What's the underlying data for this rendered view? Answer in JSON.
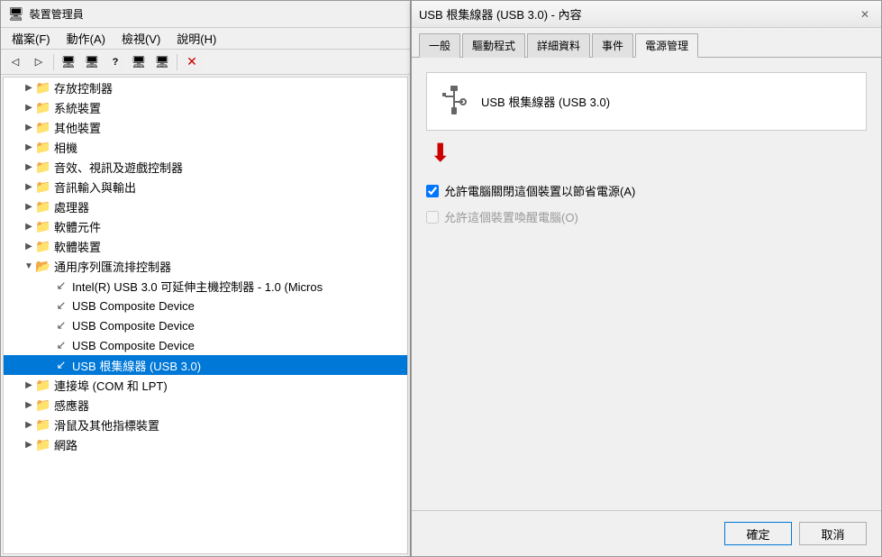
{
  "deviceManager": {
    "title": "裝置管理員",
    "menus": [
      "檔案(F)",
      "動作(A)",
      "檢視(V)",
      "說明(H)"
    ],
    "toolbar": {
      "buttons": [
        "◁",
        "▷",
        "🖥",
        "🖥",
        "?",
        "🖥",
        "🖥",
        "🗑",
        "✕"
      ]
    },
    "tree": [
      {
        "level": 1,
        "expand": "▶",
        "icon": "folder",
        "label": "存放控制器"
      },
      {
        "level": 1,
        "expand": "▶",
        "icon": "folder",
        "label": "系統裝置"
      },
      {
        "level": 1,
        "expand": "▶",
        "icon": "folder",
        "label": "其他裝置"
      },
      {
        "level": 1,
        "expand": "▶",
        "icon": "folder",
        "label": "相機"
      },
      {
        "level": 1,
        "expand": "▶",
        "icon": "folder",
        "label": "音效、視訊及遊戲控制器"
      },
      {
        "level": 1,
        "expand": "▶",
        "icon": "folder",
        "label": "音訊輸入與輸出"
      },
      {
        "level": 1,
        "expand": "▶",
        "icon": "folder",
        "label": "處理器"
      },
      {
        "level": 1,
        "expand": "▶",
        "icon": "folder",
        "label": "軟體元件"
      },
      {
        "level": 1,
        "expand": "▶",
        "icon": "folder",
        "label": "軟體裝置"
      },
      {
        "level": 1,
        "expand": "▼",
        "icon": "folder",
        "label": "通用序列匯流排控制器"
      },
      {
        "level": 2,
        "expand": "",
        "icon": "device",
        "label": "Intel(R) USB 3.0 可延伸主機控制器 - 1.0 (Micros"
      },
      {
        "level": 2,
        "expand": "",
        "icon": "device",
        "label": "USB Composite Device"
      },
      {
        "level": 2,
        "expand": "",
        "icon": "device",
        "label": "USB Composite Device"
      },
      {
        "level": 2,
        "expand": "",
        "icon": "device",
        "label": "USB Composite Device"
      },
      {
        "level": 2,
        "expand": "",
        "icon": "device",
        "label": "USB 根集線器 (USB 3.0)",
        "selected": true
      },
      {
        "level": 1,
        "expand": "▶",
        "icon": "folder",
        "label": "連接埠 (COM 和 LPT)"
      },
      {
        "level": 1,
        "expand": "▶",
        "icon": "folder",
        "label": "感應器"
      },
      {
        "level": 1,
        "expand": "▶",
        "icon": "folder",
        "label": "滑鼠及其他指標裝置"
      },
      {
        "level": 1,
        "expand": "▶",
        "icon": "folder",
        "label": "網路"
      }
    ]
  },
  "properties": {
    "title": "USB 根集線器 (USB 3.0) - 內容",
    "close_label": "✕",
    "tabs": [
      "一般",
      "驅動程式",
      "詳細資料",
      "事件",
      "電源管理"
    ],
    "active_tab": "電源管理",
    "device_name": "USB 根集線器 (USB 3.0)",
    "power_options": {
      "option1_label": "允許電腦關閉這個裝置以節省電源(A)",
      "option1_checked": true,
      "option2_label": "允許這個裝置喚醒電腦(O)",
      "option2_checked": false,
      "option2_disabled": true
    },
    "footer": {
      "ok_label": "確定",
      "cancel_label": "取消"
    }
  }
}
